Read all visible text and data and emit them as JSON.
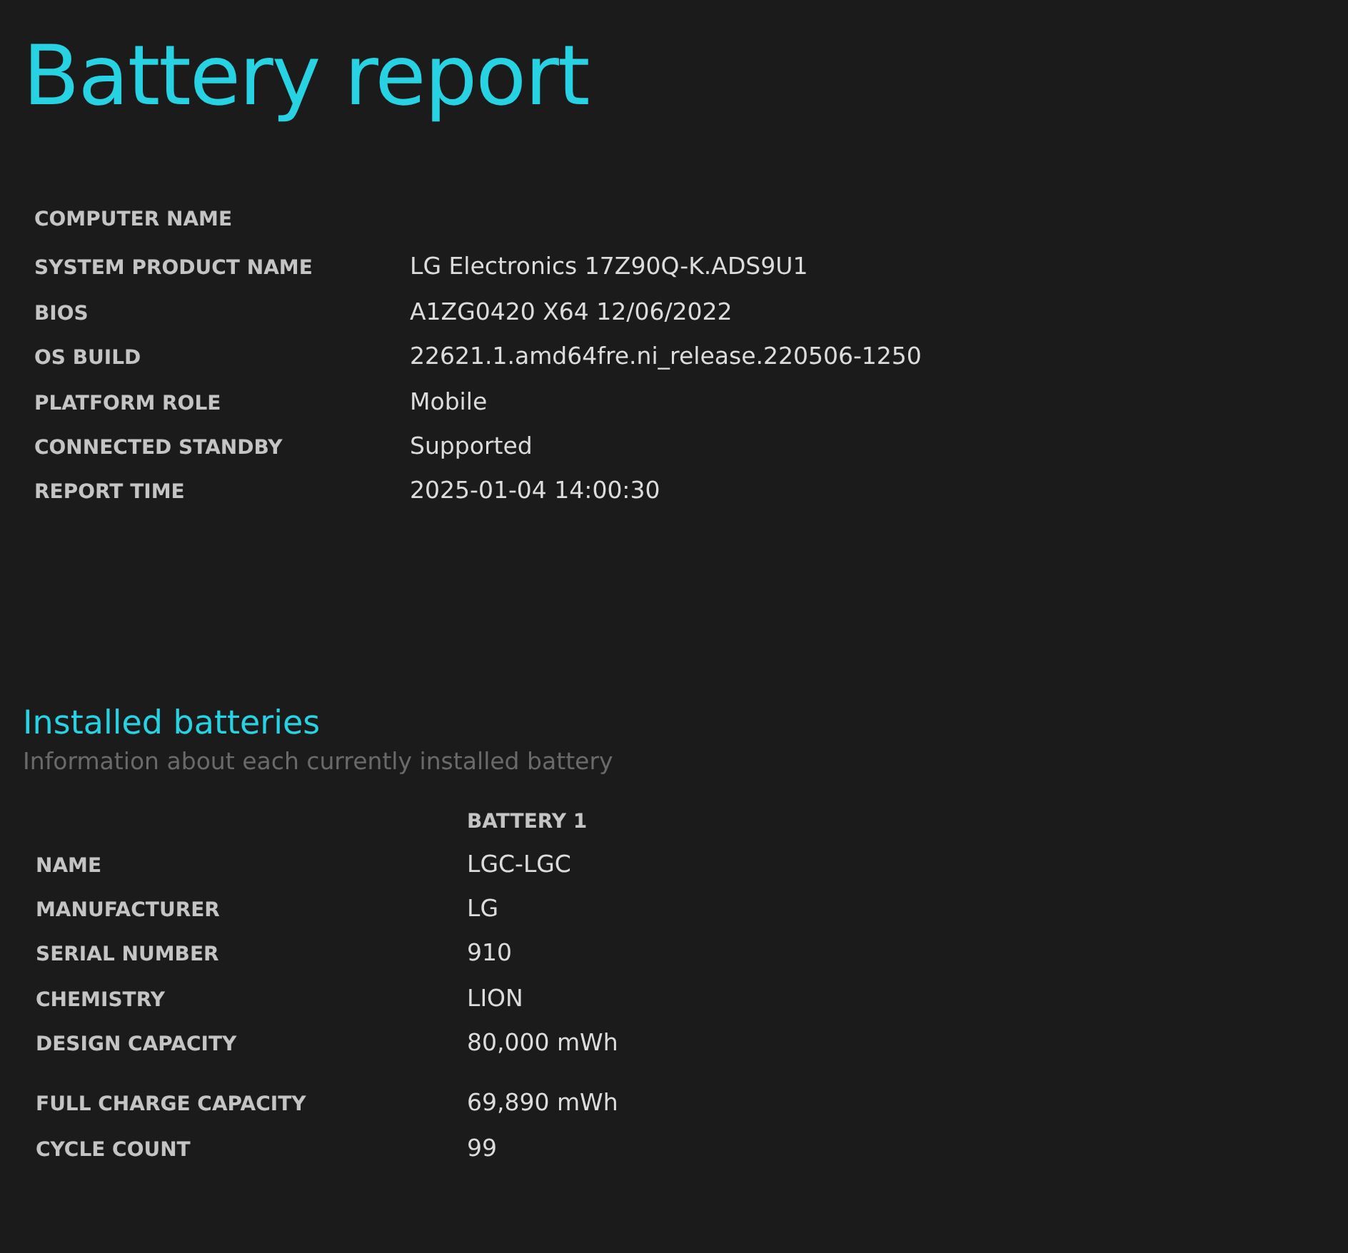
{
  "title": "Battery report",
  "system_info": [
    {
      "label": "COMPUTER NAME"
    },
    {
      "label": "SYSTEM PRODUCT NAME",
      "value": "LG Electronics 17Z90Q-K.ADS9U1"
    },
    {
      "label": "BIOS",
      "value": "A1ZG0420 X64 12/06/2022"
    },
    {
      "label": "OS BUILD",
      "value": "22621.1.amd64fre.ni_release.220506-1250"
    },
    {
      "label": "PLATFORM ROLE",
      "value": "Mobile"
    },
    {
      "label": "CONNECTED STANDBY",
      "value": "Supported"
    },
    {
      "label": "REPORT TIME",
      "value": "2025-01-04  14:00:30"
    }
  ],
  "installed_batteries": {
    "heading": "Installed batteries",
    "subtitle": "Information about each currently installed battery",
    "column": "BATTERY 1",
    "row_groups": [
      [
        {
          "label": "NAME",
          "value": "LGC-LGC"
        },
        {
          "label": "MANUFACTURER",
          "value": "LG"
        },
        {
          "label": "SERIAL NUMBER",
          "value": "910"
        },
        {
          "label": "CHEMISTRY",
          "value": "LION"
        },
        {
          "label": "DESIGN CAPACITY",
          "value": "80,000 mWh"
        }
      ],
      [
        {
          "label": "FULL CHARGE CAPACITY",
          "value": "69,890 mWh"
        },
        {
          "label": "CYCLE COUNT",
          "value": "99"
        }
      ]
    ]
  }
}
